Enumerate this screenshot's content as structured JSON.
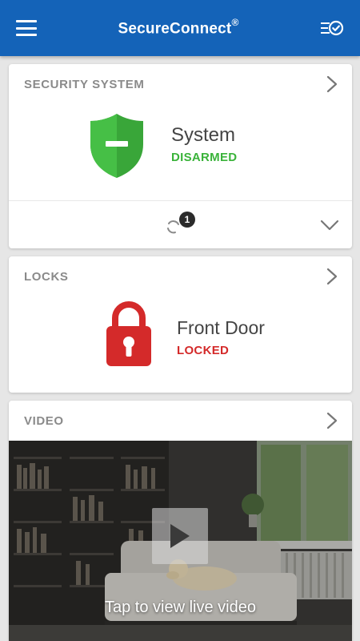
{
  "app": {
    "title": "SecureConnect",
    "title_mark": "®",
    "bar_color": "#1463b8",
    "menu_icon": "hamburger-menu-icon",
    "checklist_icon": "checklist-icon"
  },
  "security": {
    "header": "SECURITY SYSTEM",
    "name": "System",
    "status": "DISARMED",
    "status_color": "#3ab33a",
    "icon": "shield-minus-icon",
    "sync_badge": "1"
  },
  "locks": {
    "header": "LOCKS",
    "name": "Front Door",
    "status": "LOCKED",
    "status_color": "#d42a2a",
    "icon": "padlock-icon"
  },
  "video": {
    "header": "VIDEO",
    "caption": "Tap to view live video",
    "play_icon": "play-icon"
  }
}
